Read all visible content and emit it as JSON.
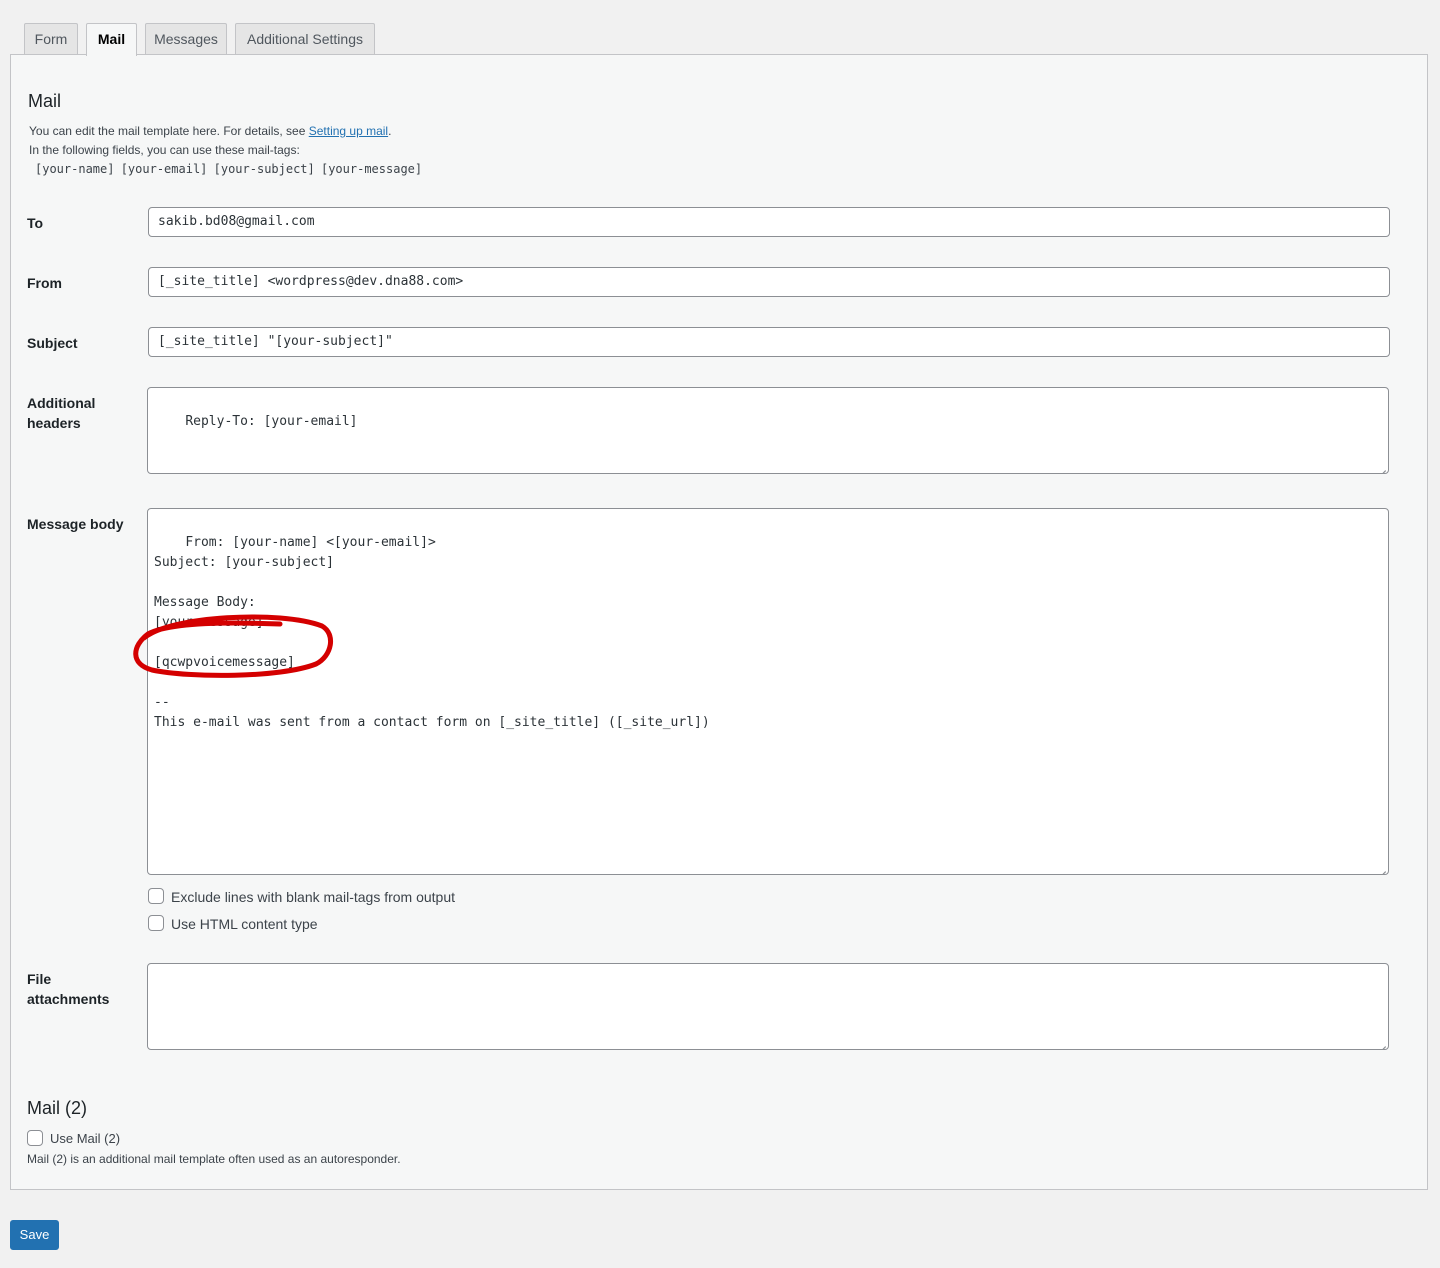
{
  "tabs": [
    {
      "label": "Form"
    },
    {
      "label": "Mail"
    },
    {
      "label": "Messages"
    },
    {
      "label": "Additional Settings"
    }
  ],
  "mail": {
    "title": "Mail",
    "intro_text": "You can edit the mail template here. For details, see ",
    "intro_link": "Setting up mail",
    "intro_end": ".",
    "tags_intro": "In the following fields, you can use these mail-tags:",
    "mail_tags": "[your-name] [your-email] [your-subject] [your-message]"
  },
  "fields": {
    "to": {
      "label": "To",
      "value": "sakib.bd08@gmail.com"
    },
    "from": {
      "label": "From",
      "value": "[_site_title] <wordpress@dev.dna88.com>"
    },
    "subject": {
      "label": "Subject",
      "value": "[_site_title] \"[your-subject]\""
    },
    "additional_headers": {
      "label_line1": "Additional",
      "label_line2": "headers",
      "value": "Reply-To: [your-email]"
    },
    "message_body": {
      "label": "Message body",
      "value": "From: [your-name] <[your-email]>\nSubject: [your-subject]\n\nMessage Body:\n[your-message]\n\n[qcwpvoicemessage]\n\n--\nThis e-mail was sent from a contact form on [_site_title] ([_site_url])"
    },
    "file_attachments": {
      "label_line1": "File",
      "label_line2": "attachments",
      "value": ""
    }
  },
  "options": {
    "exclude_blank": {
      "label": "Exclude lines with blank mail-tags from output",
      "checked": false
    },
    "use_html": {
      "label": "Use HTML content type",
      "checked": false
    }
  },
  "mail2": {
    "title": "Mail (2)",
    "use_label": "Use Mail (2)",
    "checked": false,
    "description": "Mail (2) is an additional mail template often used as an autoresponder."
  },
  "save_label": "Save",
  "colors": {
    "annotation": "#d40000",
    "primary_button": "#2271b1"
  }
}
